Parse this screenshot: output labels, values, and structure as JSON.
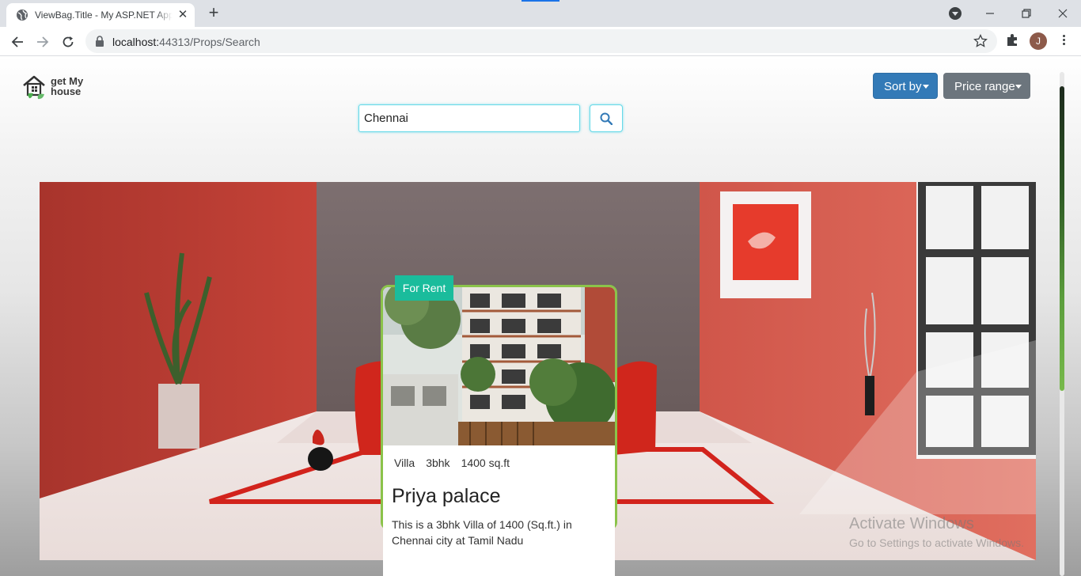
{
  "browser": {
    "tab_title": "ViewBag.Title - My ASP.NET Application",
    "url_host": "localhost:",
    "url_port": "44313",
    "url_path": "/Props/Search",
    "profile_initial": "J"
  },
  "page": {
    "logo": {
      "line1": "get My",
      "line2": "house"
    },
    "sort_label": "Sort by",
    "price_label": "Price range",
    "search_value": "Chennai",
    "search_icon": "search-icon"
  },
  "card": {
    "badge": "For Rent",
    "type": "Villa",
    "bhk": "3bhk",
    "area": "1400 sq.ft",
    "title": "Priya palace",
    "description": "This is a 3bhk Villa of 1400 (Sq.ft.) in Chennai city at Tamil Nadu"
  },
  "watermark": {
    "line1": "Activate Windows",
    "line2": "Go to Settings to activate Windows."
  },
  "colors": {
    "accent_teal": "#1abc9c",
    "card_border": "#8bc34a",
    "sort_btn": "#337ab7",
    "price_btn": "#6c757d"
  }
}
